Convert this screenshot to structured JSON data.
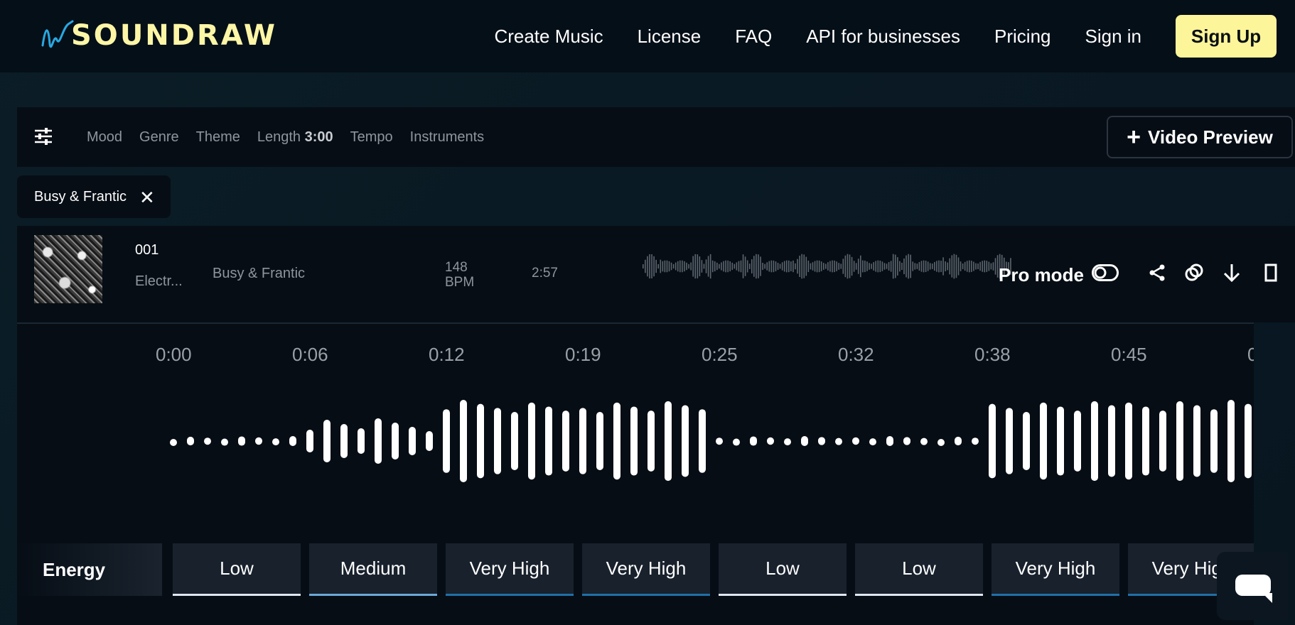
{
  "brand": {
    "name": "SOUNDRAW"
  },
  "nav": {
    "links": [
      "Create Music",
      "License",
      "FAQ",
      "API for businesses",
      "Pricing",
      "Sign in"
    ],
    "signup": "Sign Up"
  },
  "filters": {
    "items": [
      "Mood",
      "Genre",
      "Theme"
    ],
    "length_label": "Length",
    "length_value": "3:00",
    "items_after": [
      "Tempo",
      "Instruments"
    ],
    "video_preview": "Video Preview"
  },
  "tag": {
    "label": "Busy & Frantic"
  },
  "track": {
    "number": "001",
    "genre": "Electr...",
    "mood": "Busy & Frantic",
    "bpm_value": "148",
    "bpm_unit": "BPM",
    "duration": "2:57",
    "pro_mode": "Pro mode"
  },
  "timeline": {
    "ticks": [
      "0:00",
      "0:06",
      "0:12",
      "0:19",
      "0:25",
      "0:32",
      "0:38",
      "0:45",
      "0"
    ]
  },
  "energy": {
    "label": "Energy",
    "levels": [
      "Low",
      "Medium",
      "Very High",
      "Very High",
      "Low",
      "Low",
      "Very High",
      "Very High"
    ],
    "level_colors": {
      "Low": "#dfe6ee",
      "Medium": "#6aa9d8",
      "Very High": "#1f6fa8"
    }
  },
  "colors": {
    "accent_yellow": "#fdf59a",
    "logo_blue": "#29a8e0",
    "background": "#060d15"
  }
}
